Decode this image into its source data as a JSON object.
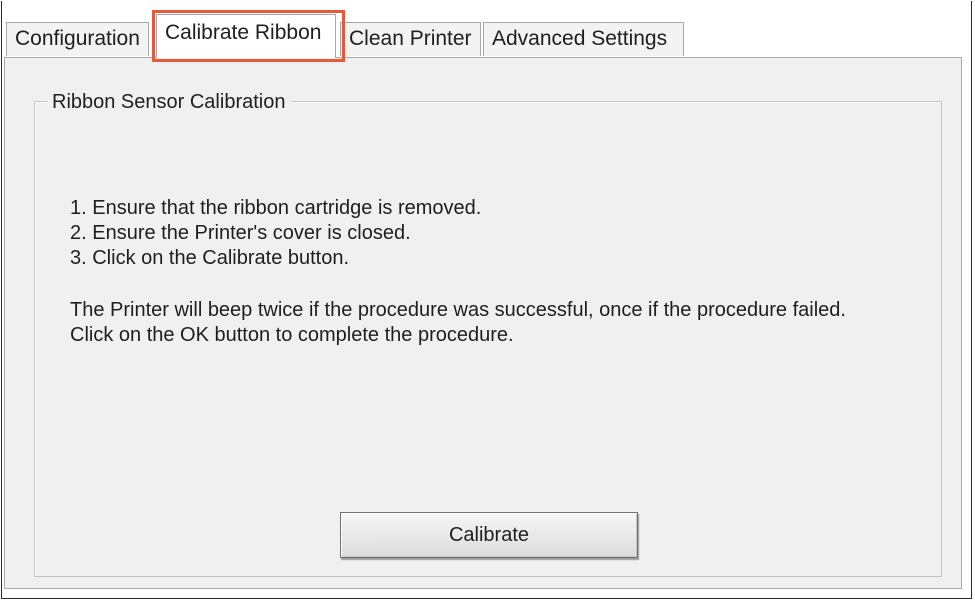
{
  "tabs": [
    {
      "label": "Configuration",
      "selected": false
    },
    {
      "label": "Calibrate Ribbon",
      "selected": true
    },
    {
      "label": "Clean Printer",
      "selected": false
    },
    {
      "label": "Advanced Settings",
      "selected": false
    }
  ],
  "highlight_color": "#e8583a",
  "group": {
    "title": "Ribbon Sensor Calibration",
    "steps": [
      "1. Ensure that the ribbon cartridge is removed.",
      "2. Ensure the Printer's cover is closed.",
      "3. Click on the Calibrate button."
    ],
    "notes": [
      "The Printer will beep twice if the procedure was successful, once if the procedure failed.",
      "Click on the OK button to complete the procedure."
    ]
  },
  "buttons": {
    "calibrate_label": "Calibrate"
  }
}
